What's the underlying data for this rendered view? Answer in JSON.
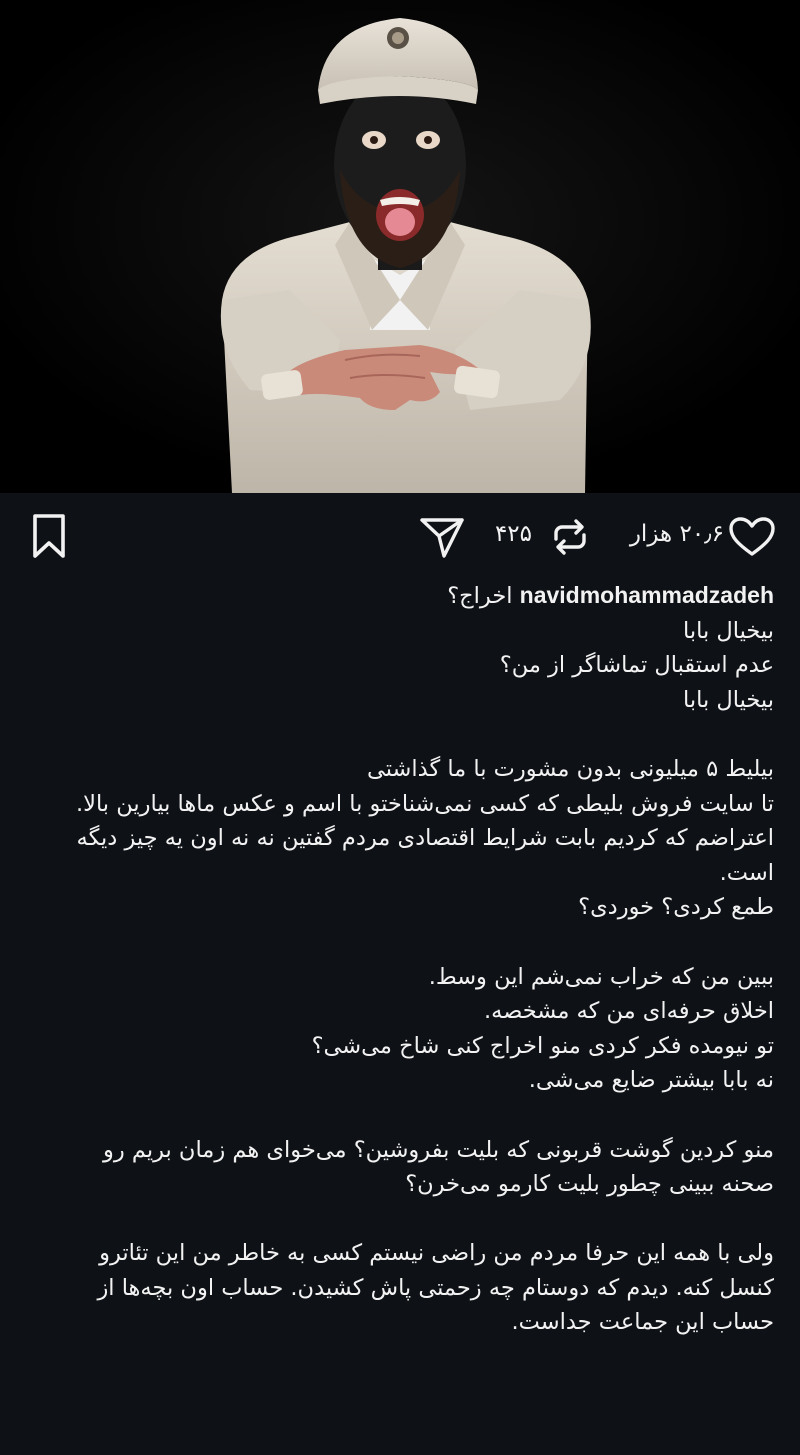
{
  "post": {
    "image": {
      "description_icon": "performer-photo"
    },
    "actions": {
      "like_icon": "heart-icon",
      "like_count": "۲۰٫۶ هزار",
      "repost_icon": "repost-icon",
      "repost_count": "۴۲۵",
      "share_icon": "send-icon",
      "save_icon": "bookmark-icon"
    },
    "caption": {
      "username": "navidmohammadzadeh",
      "first_line_text": "اخراج؟",
      "lines": [
        "بیخیال بابا",
        "عدم استقبال تماشاگر از من؟",
        "بیخیال بابا",
        "",
        "بیلیط ۵ میلیونی بدون مشورت با ما گذاشتی",
        "تا سایت فروش بلیطی که کسی نمی‌شناختو با اسم و عکس ماها بیارین بالا.",
        "اعتراضم که کردیم بابت شرایط اقتصادی مردم گفتین نه نه اون یه چیز دیگه",
        "است.",
        "طمع کردی؟ خوردی؟",
        "",
        "ببین من که خراب نمی‌شم این وسط.",
        "اخلاق حرفه‌ای من که مشخصه.",
        "تو نیومده فکر کردی منو اخراج کنی شاخ می‌شی؟",
        "نه بابا بیشتر ضایع می‌شی.",
        "",
        "منو کردین گوشت قربونی که بلیت بفروشین؟ می‌خوای هم زمان بریم رو",
        "صحنه ببینی چطور بلیت کارمو می‌خرن؟",
        "",
        "ولی با همه این حرفا مردم من راضی نیستم کسی به خاطر من این تئاترو",
        "کنسل کنه. دیدم که دوستام چه زحمتی پاش کشیدن. حساب اون بچه‌ها از",
        "حساب این جماعت جداست."
      ]
    }
  },
  "colors": {
    "page_background": "#0e1116",
    "image_background": "#000000",
    "text": "#f2f2f2"
  }
}
